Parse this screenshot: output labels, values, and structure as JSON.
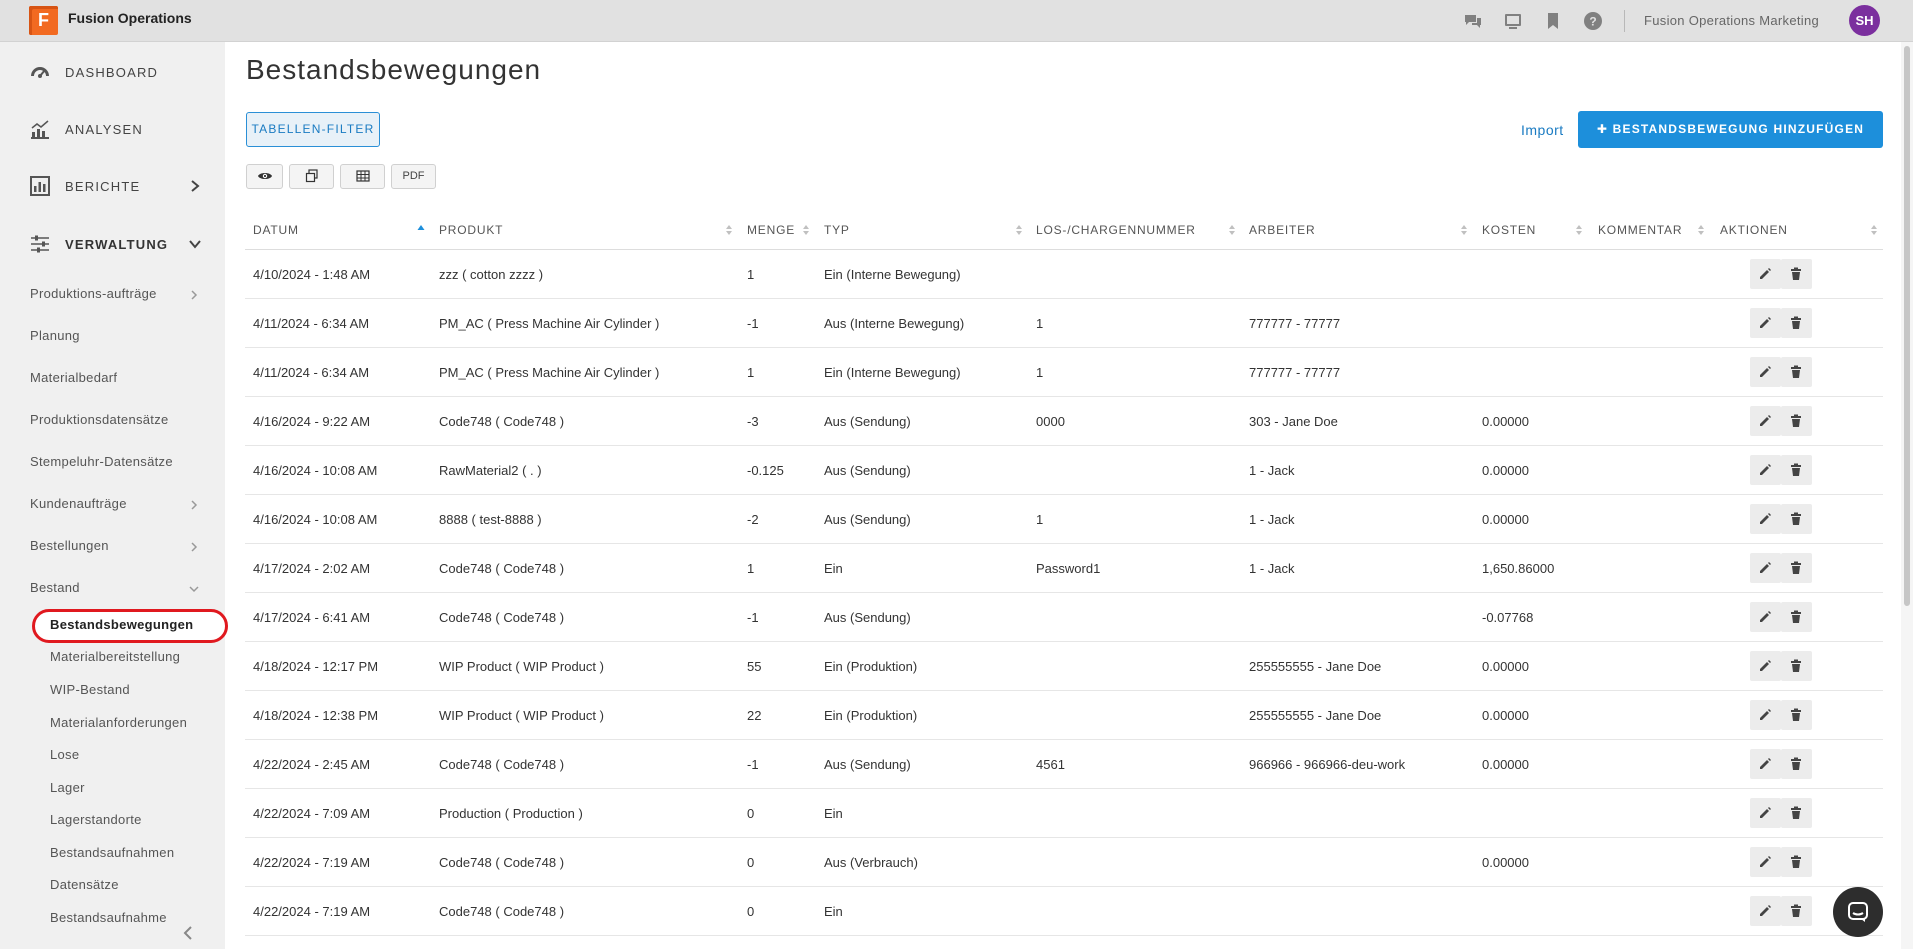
{
  "app": {
    "logo_letter": "F",
    "title": "Fusion Operations",
    "org": "Fusion Operations Marketing",
    "avatar_initials": "SH",
    "brand_color": "#f26a21",
    "avatar_color": "#7b2f9e"
  },
  "top_icons": [
    "chat-icon",
    "display-icon",
    "bookmark-icon",
    "help-icon"
  ],
  "sidebar": {
    "main": [
      {
        "label": "DASHBOARD",
        "icon": "speedometer-icon"
      },
      {
        "label": "ANALYSEN",
        "icon": "line-chart-icon"
      },
      {
        "label": "BERICHTE",
        "icon": "bar-chart-icon"
      },
      {
        "label": "VERWALTUNG",
        "icon": "sliders-icon"
      }
    ],
    "sub": [
      {
        "label": "Produktions-aufträge",
        "chevron": "right"
      },
      {
        "label": "Planung"
      },
      {
        "label": "Materialbedarf"
      },
      {
        "label": "Produktionsdatensätze"
      },
      {
        "label": "Stempeluhr-Datensätze"
      },
      {
        "label": "Kundenaufträge",
        "chevron": "right"
      },
      {
        "label": "Bestellungen",
        "chevron": "right"
      },
      {
        "label": "Bestand",
        "chevron": "down"
      }
    ],
    "bestand_items": [
      "Bestandsbewegungen",
      "Materialbereitstellung",
      "WIP-Bestand",
      "Materialanforderungen",
      "Lose",
      "Lager",
      "Lagerstandorte",
      "Bestandsaufnahmen",
      "Datensätze",
      "Bestandsaufnahme"
    ]
  },
  "page": {
    "title": "Bestandsbewegungen",
    "filter_label": "TABELLEN-FILTER",
    "import_label": "Import",
    "add_label": "BESTANDSBEWEGUNG HINZUFÜGEN",
    "add_color": "#1d8fdb",
    "pdf_label": "PDF"
  },
  "table": {
    "columns": [
      "DATUM",
      "PRODUKT",
      "MENGE",
      "TYP",
      "LOS-/CHARGENNUMMER",
      "ARBEITER",
      "KOSTEN",
      "KOMMENTAR",
      "AKTIONEN"
    ],
    "rows": [
      [
        "4/10/2024 - 1:48 AM",
        "zzz ( cotton zzzz )",
        "1",
        "Ein (Interne Bewegung)",
        "",
        "",
        "",
        ""
      ],
      [
        "4/11/2024 - 6:34 AM",
        "PM_AC ( Press Machine Air Cylinder )",
        "-1",
        "Aus (Interne Bewegung)",
        "1",
        "777777 - 77777",
        "",
        ""
      ],
      [
        "4/11/2024 - 6:34 AM",
        "PM_AC ( Press Machine Air Cylinder )",
        "1",
        "Ein (Interne Bewegung)",
        "1",
        "777777 - 77777",
        "",
        ""
      ],
      [
        "4/16/2024 - 9:22 AM",
        "Code748 ( Code748 )",
        "-3",
        "Aus (Sendung)",
        "0000",
        "303 - Jane Doe",
        "0.00000",
        ""
      ],
      [
        "4/16/2024 - 10:08 AM",
        "RawMaterial2 ( . )",
        "-0.125",
        "Aus (Sendung)",
        "",
        "1 - Jack",
        "0.00000",
        ""
      ],
      [
        "4/16/2024 - 10:08 AM",
        "8888 ( test-8888 )",
        "-2",
        "Aus (Sendung)",
        "1",
        "1 - Jack",
        "0.00000",
        ""
      ],
      [
        "4/17/2024 - 2:02 AM",
        "Code748 ( Code748 )",
        "1",
        "Ein",
        "Password1",
        "1 - Jack",
        "1,650.86000",
        ""
      ],
      [
        "4/17/2024 - 6:41 AM",
        "Code748 ( Code748 )",
        "-1",
        "Aus (Sendung)",
        "",
        "",
        "-0.07768",
        ""
      ],
      [
        "4/18/2024 - 12:17 PM",
        "WIP Product ( WIP Product )",
        "55",
        "Ein (Produktion)",
        "",
        "255555555 - Jane Doe",
        "0.00000",
        ""
      ],
      [
        "4/18/2024 - 12:38 PM",
        "WIP Product ( WIP Product )",
        "22",
        "Ein (Produktion)",
        "",
        "255555555 - Jane Doe",
        "0.00000",
        ""
      ],
      [
        "4/22/2024 - 2:45 AM",
        "Code748 ( Code748 )",
        "-1",
        "Aus (Sendung)",
        "4561",
        "966966 - 966966-deu-work",
        "0.00000",
        ""
      ],
      [
        "4/22/2024 - 7:09 AM",
        "Production ( Production )",
        "0",
        "Ein",
        "",
        "",
        "",
        ""
      ],
      [
        "4/22/2024 - 7:19 AM",
        "Code748 ( Code748 )",
        "0",
        "Aus (Verbrauch)",
        "",
        "",
        "0.00000",
        ""
      ],
      [
        "4/22/2024 - 7:19 AM",
        "Code748 ( Code748 )",
        "0",
        "Ein",
        "",
        "",
        "",
        ""
      ]
    ]
  }
}
